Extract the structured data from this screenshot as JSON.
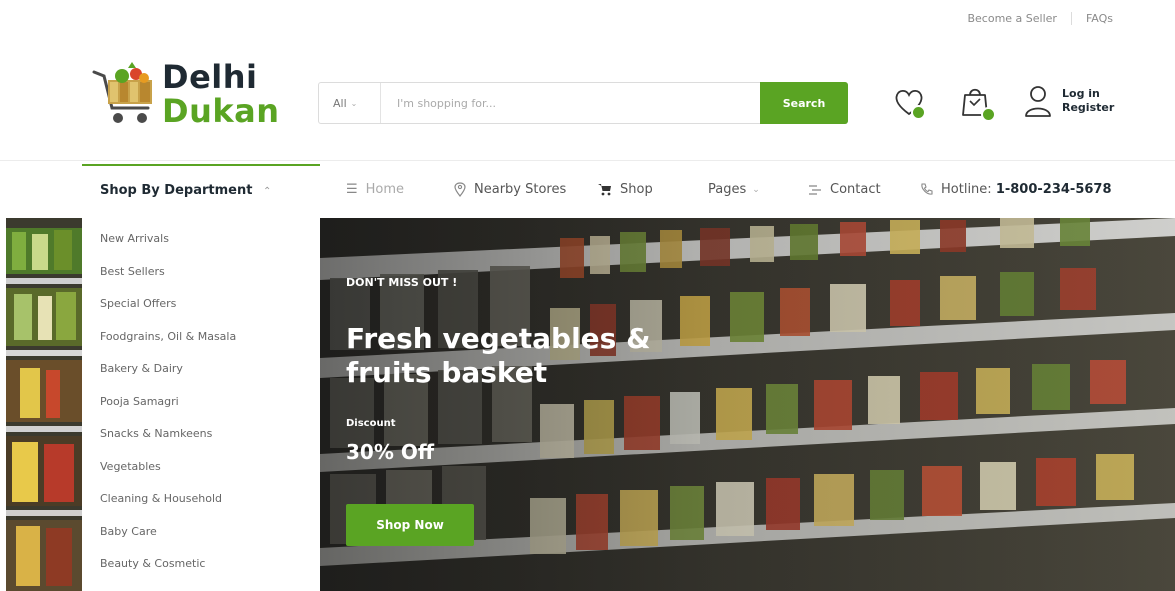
{
  "topbar": {
    "become_seller": "Become a Seller",
    "faqs": "FAQs"
  },
  "logo": {
    "line1": "Delhi",
    "line2": "Dukan"
  },
  "search": {
    "category": "All",
    "placeholder": "I'm shopping for...",
    "button": "Search"
  },
  "account": {
    "login": "Log in",
    "register": "Register"
  },
  "icons": {
    "wishlist": "heart-icon",
    "cart": "shopping-bag-icon",
    "user": "user-icon"
  },
  "nav": {
    "department": "Shop By Department",
    "home": "Home",
    "nearby": "Nearby Stores",
    "shop": "Shop",
    "pages": "Pages",
    "contact": "Contact",
    "hotline_label": "Hotline:",
    "hotline_number": "1-800-234-5678"
  },
  "departments": [
    "New Arrivals",
    "Best Sellers",
    "Special Offers",
    "Foodgrains, Oil & Masala",
    "Bakery & Dairy",
    "Pooja Samagri",
    "Snacks & Namkeens",
    "Vegetables",
    "Cleaning & Household",
    "Baby Care",
    "Beauty & Cosmetic"
  ],
  "hero": {
    "tag": "DON'T MISS OUT !",
    "title": "Fresh vegetables & fruits basket",
    "discount_label": "Discount",
    "discount_value": "30% Off",
    "cta": "Shop Now"
  },
  "colors": {
    "accent": "#5aa423",
    "dark": "#1f2a33"
  }
}
